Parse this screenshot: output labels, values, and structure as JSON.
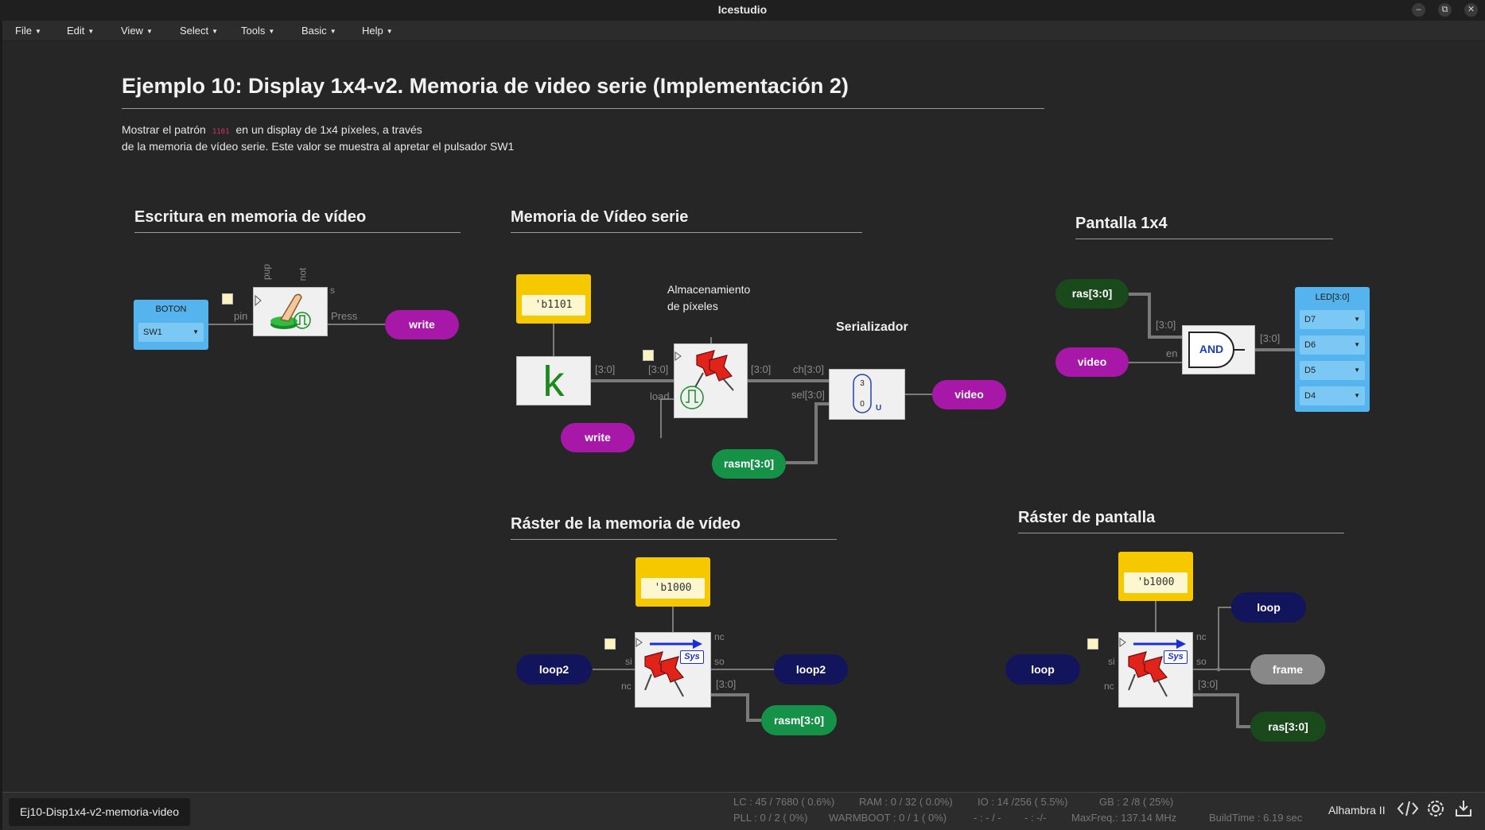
{
  "window": {
    "title": "Icestudio"
  },
  "menu": [
    {
      "label": "File"
    },
    {
      "label": "Edit"
    },
    {
      "label": "View"
    },
    {
      "label": "Select"
    },
    {
      "label": "Tools"
    },
    {
      "label": "Basic"
    },
    {
      "label": "Help"
    }
  ],
  "page": {
    "title": "Ejemplo 10: Display 1x4-v2. Memoria de video serie (Implementación 2)",
    "desc_before": "Mostrar el patrón",
    "desc_code": "1101",
    "desc_after": "en un display de 1x4 píxeles, a través",
    "desc_line2": "de la memoria de vídeo serie. Este valor se muestra al apretar el pulsador SW1"
  },
  "sections": {
    "escritura": "Escritura en memoria de vídeo",
    "memoria": "Memoria de Vídeo serie",
    "pantalla": "Pantalla 1x4",
    "raster_mem": "Ráster de la memoria de vídeo",
    "raster_pant": "Ráster de pantalla"
  },
  "notes": {
    "almacen1": "Almacenamiento",
    "almacen2": "de píxeles",
    "serializador": "Serializador"
  },
  "boton": {
    "title": "BOTON",
    "value": "SW1"
  },
  "button_block": {
    "pup": "pup",
    "not": "not",
    "s": "s",
    "pin": "pin",
    "press": "Press"
  },
  "labels": {
    "write": "write",
    "video": "video",
    "rasm": "rasm[3:0]",
    "ras": "ras[3:0]",
    "loop2": "loop2",
    "loop": "loop",
    "frame": "frame"
  },
  "constants": {
    "c1101": "'b1101",
    "c1000": "'b1000"
  },
  "k_block": "k",
  "reg_block": {
    "in": "[3:0]",
    "out": "[3:0]",
    "load": "load"
  },
  "serial_block": {
    "ch": "ch[3:0]",
    "sel": "sel[3:0]",
    "top": "3",
    "bot": "0",
    "u": "U",
    "wire": "[3:0]"
  },
  "and_block": {
    "label": "AND",
    "in": "[3:0]",
    "en": "en",
    "out": "[3:0]"
  },
  "led_block": {
    "title": "LED[3:0]",
    "pins": [
      "D7",
      "D6",
      "D5",
      "D4"
    ]
  },
  "sys_block": {
    "badge": "Sys",
    "nc": "nc",
    "si": "si",
    "so": "so",
    "bus": "[3:0]"
  },
  "status": {
    "project": "Ej10-Disp1x4-v2-memoria-video",
    "lc": "LC : 45 / 7680 ( 0.6%)",
    "ram": "RAM : 0 / 32 ( 0.0%)",
    "io": "IO : 14 /256 ( 5.5%)",
    "gb": "GB : 2 /8 ( 25%)",
    "pll": "PLL : 0 / 2 ( 0%)",
    "warmboot": "WARMBOOT : 0 / 1 ( 0%)",
    "dash1": "- : - / -",
    "dash2": "- : -/-",
    "maxfreq": "MaxFreq.: 137.14 MHz",
    "buildtime": "BuildTime : 6.19 sec",
    "board": "Alhambra II"
  },
  "icons": [
    "minimize-icon",
    "restore-icon",
    "close-icon",
    "code-icon",
    "settings-icon",
    "download-icon",
    "pushpin-icon",
    "hand-button-icon"
  ],
  "colors": {
    "purple": "#a818a8",
    "green": "#169248",
    "dark_green": "#1a4a1c",
    "navy": "#13155c",
    "const_yellow": "#f5c800",
    "io_blue": "#55b4ee"
  }
}
